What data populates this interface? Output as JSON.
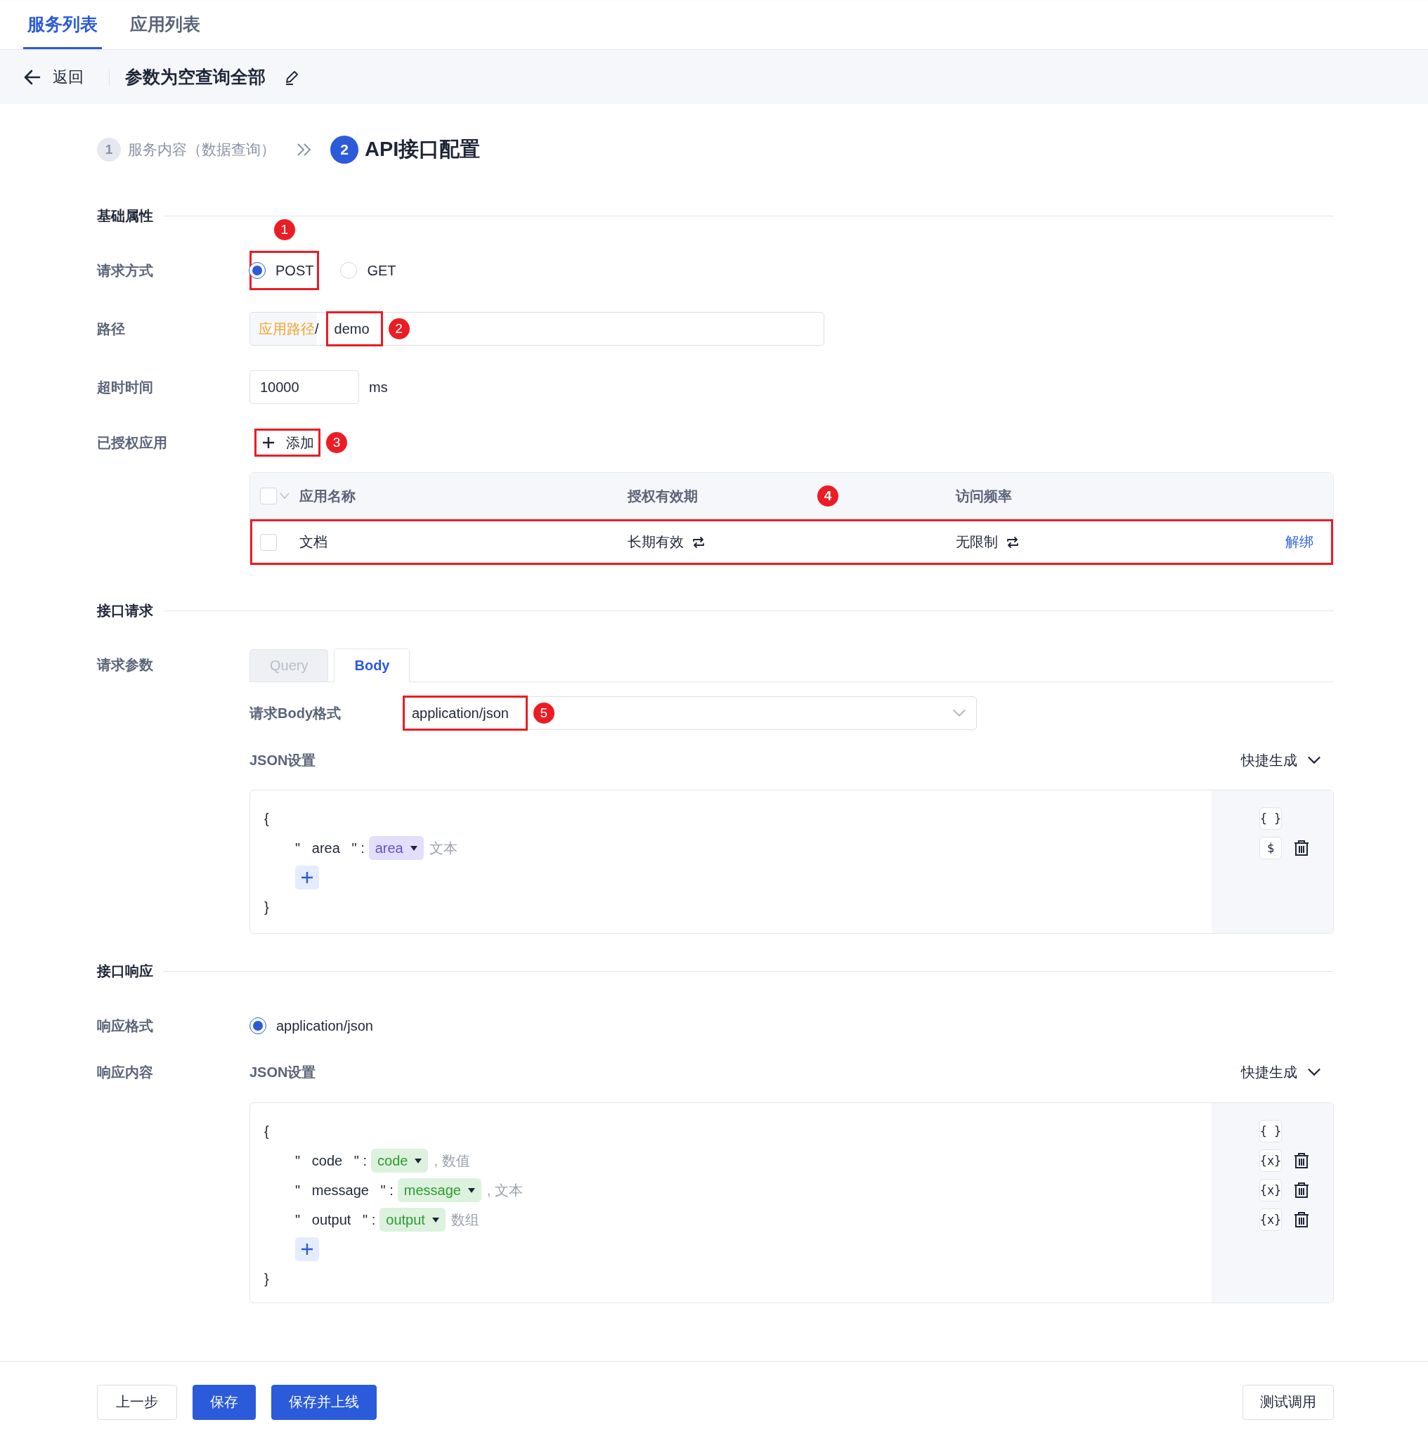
{
  "top_tabs": [
    {
      "label": "服务列表",
      "selected": true
    },
    {
      "label": "应用列表",
      "selected": false
    }
  ],
  "header": {
    "back": "返回",
    "title": "参数为空查询全部"
  },
  "steps": [
    {
      "number": "1",
      "label": "服务内容（数据查询）",
      "active": false
    },
    {
      "number": "2",
      "label": "API接口配置",
      "active": true
    }
  ],
  "basic": {
    "heading": "基础属性",
    "method": {
      "label": "请求方式",
      "annotation": "1",
      "options": [
        {
          "label": "POST",
          "selected": true
        },
        {
          "label": "GET",
          "selected": false
        }
      ]
    },
    "path": {
      "label": "路径",
      "prefix": "应用路径",
      "separator": "/",
      "value": "demo",
      "annotation": "2"
    },
    "timeout": {
      "label": "超时时间",
      "value": "10000",
      "unit": "ms"
    },
    "apps": {
      "label": "已授权应用",
      "add_button": "添加",
      "add_annotation": "3",
      "table": {
        "select_all_checked": false,
        "columns": [
          "应用名称",
          "授权有效期",
          "访问频率"
        ],
        "annotation": "4",
        "rows": [
          {
            "checked": false,
            "highlighted": true,
            "name": "文档",
            "validity": "长期有效",
            "rate": "无限制",
            "action": "解绑"
          }
        ]
      }
    }
  },
  "request": {
    "heading": "接口请求",
    "params_label": "请求参数",
    "tabs": [
      {
        "label": "Query",
        "selected": false
      },
      {
        "label": "Body",
        "selected": true
      }
    ],
    "body_format_label": "请求Body格式",
    "body_format": "application/json",
    "body_format_annotation": "5",
    "json_label": "JSON设置",
    "quick_generate": "快捷生成",
    "editor": {
      "kind": "request",
      "open_brace": "{",
      "close_brace": "}",
      "root_icon": "{ }",
      "fields": [
        {
          "key": "\"   area   \" :",
          "value": "area",
          "type": "文本",
          "icon": "$"
        }
      ]
    }
  },
  "response": {
    "heading": "接口响应",
    "format_label": "响应格式",
    "format_options": [
      {
        "label": "application/json",
        "selected": true
      }
    ],
    "content_label": "响应内容",
    "json_label": "JSON设置",
    "quick_generate": "快捷生成",
    "editor": {
      "kind": "response",
      "open_brace": "{",
      "close_brace": "}",
      "root_icon": "{ }",
      "fields": [
        {
          "key": "\"   code   \" :",
          "value": "code",
          "type": ", 数值",
          "icon": "{x}"
        },
        {
          "key": "\"   message   \" :",
          "value": "message",
          "type": ", 文本",
          "icon": "{x}"
        },
        {
          "key": "\"   output   \" :",
          "value": "output",
          "type": "数组",
          "icon": "{x}"
        }
      ]
    }
  },
  "footer": {
    "buttons": [
      {
        "label": "上一步",
        "kind": "secondary"
      },
      {
        "label": "保存",
        "kind": "primary"
      },
      {
        "label": "保存并上线",
        "kind": "primary"
      }
    ],
    "test_button": "测试调用"
  }
}
